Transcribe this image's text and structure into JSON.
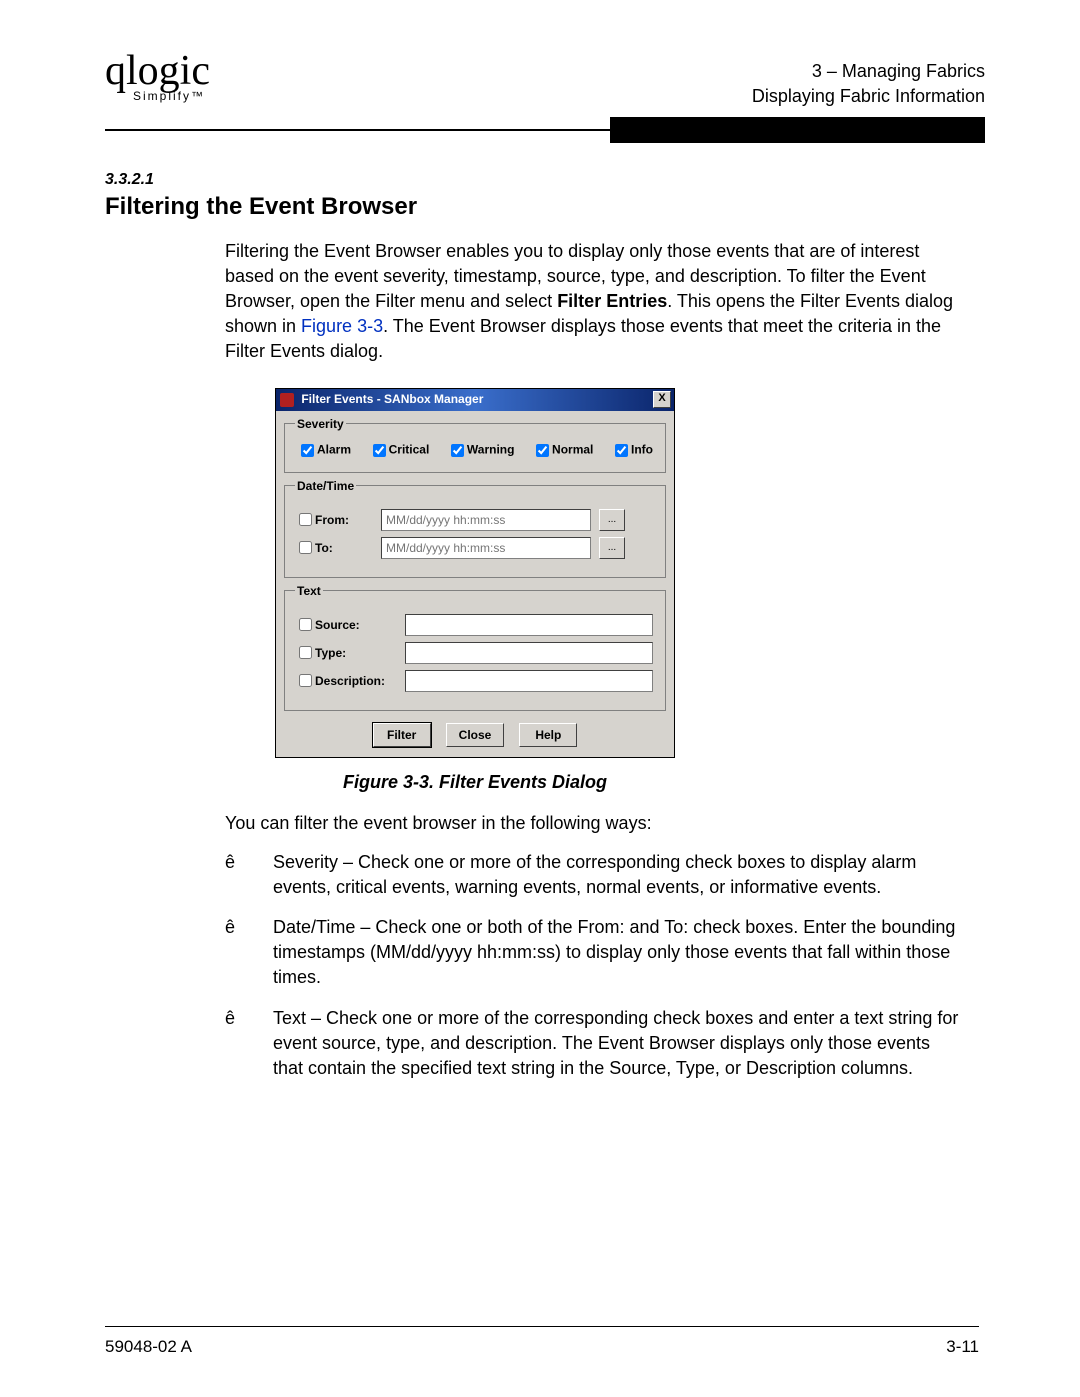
{
  "logo": {
    "text": "qlogic",
    "sub": "Simplify™"
  },
  "header": {
    "line1": "3 – Managing Fabrics",
    "line2": "Displaying Fabric Information"
  },
  "section_number": "3.3.2.1",
  "section_title": "Filtering the Event Browser",
  "intro": {
    "pre": "Filtering the Event Browser enables you to display only those events that are of interest based on the event severity, timestamp, source, type, and description. To filter the Event Browser, open the Filter menu and select ",
    "bold": "Filter Entries",
    "mid": ". This opens the Filter Events dialog shown in ",
    "link": "Figure 3-3",
    "post": ". The Event Browser displays those events that meet the criteria in the Filter Events dialog."
  },
  "dialog": {
    "title": "Filter Events - SANbox Manager",
    "groups": {
      "severity": "Severity",
      "datetime": "Date/Time",
      "text": "Text"
    },
    "severity": {
      "alarm": "Alarm",
      "critical": "Critical",
      "warning": "Warning",
      "normal": "Normal",
      "info": "Info"
    },
    "datetime": {
      "from_label": "From:",
      "to_label": "To:",
      "placeholder": "MM/dd/yyyy hh:mm:ss",
      "picker": "..."
    },
    "text_fields": {
      "source": "Source:",
      "type": "Type:",
      "description": "Description:"
    },
    "buttons": {
      "filter": "Filter",
      "close": "Close",
      "help": "Help"
    },
    "close_icon": "X"
  },
  "figure_caption": "Figure 3-3.  Filter Events Dialog",
  "ways_intro": "You can filter the event browser in the following ways:",
  "bullets": [
    "Severity – Check one or more of the corresponding check boxes to display alarm events, critical events, warning events, normal events, or informative events.",
    "Date/Time – Check one or both of the From: and To: check boxes. Enter the bounding timestamps (MM/dd/yyyy hh:mm:ss) to display only those events that fall within those times.",
    "Text – Check one or more of the corresponding check boxes and enter a text string for event source, type, and description. The Event Browser displays only those events that contain the specified text string in the Source, Type, or Description columns."
  ],
  "footer": {
    "left": "59048-02  A",
    "right": "3-11"
  }
}
